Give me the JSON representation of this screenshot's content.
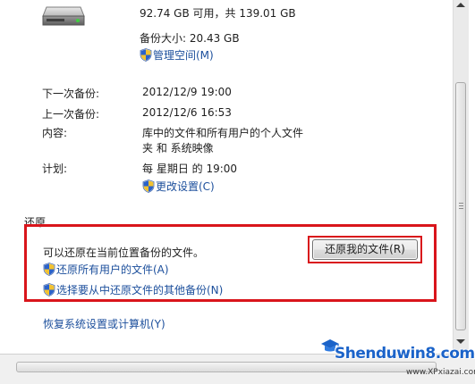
{
  "drive": {
    "space_text": "92.74 GB 可用，共 139.01 GB"
  },
  "backup_size": {
    "label": "备份大小: 20.43 GB"
  },
  "manage_space": {
    "label": "管理空间(M)"
  },
  "details": {
    "next_label": "下一次备份:",
    "next_value": "2012/12/9 19:00",
    "last_label": "上一次备份:",
    "last_value": "2012/12/6 16:53",
    "content_label": "内容:",
    "content_value_line1": "库中的文件和所有用户的个人文件",
    "content_value_line2": "夹 和 系统映像",
    "schedule_label": "计划:",
    "schedule_value": "每 星期日 的 19:00",
    "change_settings": "更改设置(C)"
  },
  "restore": {
    "heading": "还原",
    "description": "可以还原在当前位置备份的文件。",
    "restore_my_files_button": "还原我的文件(R)",
    "restore_all_users_link": "还原所有用户的文件(A)",
    "select_other_backup_link": "选择要从中还原文件的其他备份(N)",
    "recover_system_link": "恢复系统设置或计算机(Y)"
  },
  "watermark": {
    "main": "Shenduwin8.com",
    "sub": "www.XPxiazai.com"
  },
  "colors": {
    "link": "#1c4f9c",
    "highlight": "#d9151b",
    "watermark": "#1b63c9"
  }
}
